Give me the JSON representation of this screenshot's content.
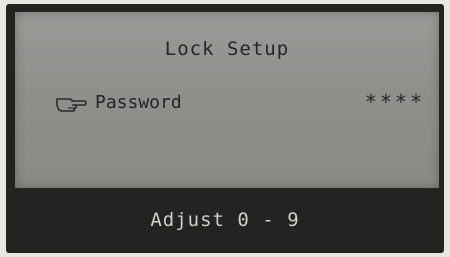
{
  "screen": {
    "title": "Lock Setup",
    "setting": {
      "icon": "pointing-hand-icon",
      "label": "Password",
      "value": "****"
    },
    "footer": "Adjust 0 - 9"
  },
  "colors": {
    "bezel": "#232322",
    "screen": "#8f908c",
    "screen_text": "#242423",
    "footer_text": "#cfcfc8"
  }
}
